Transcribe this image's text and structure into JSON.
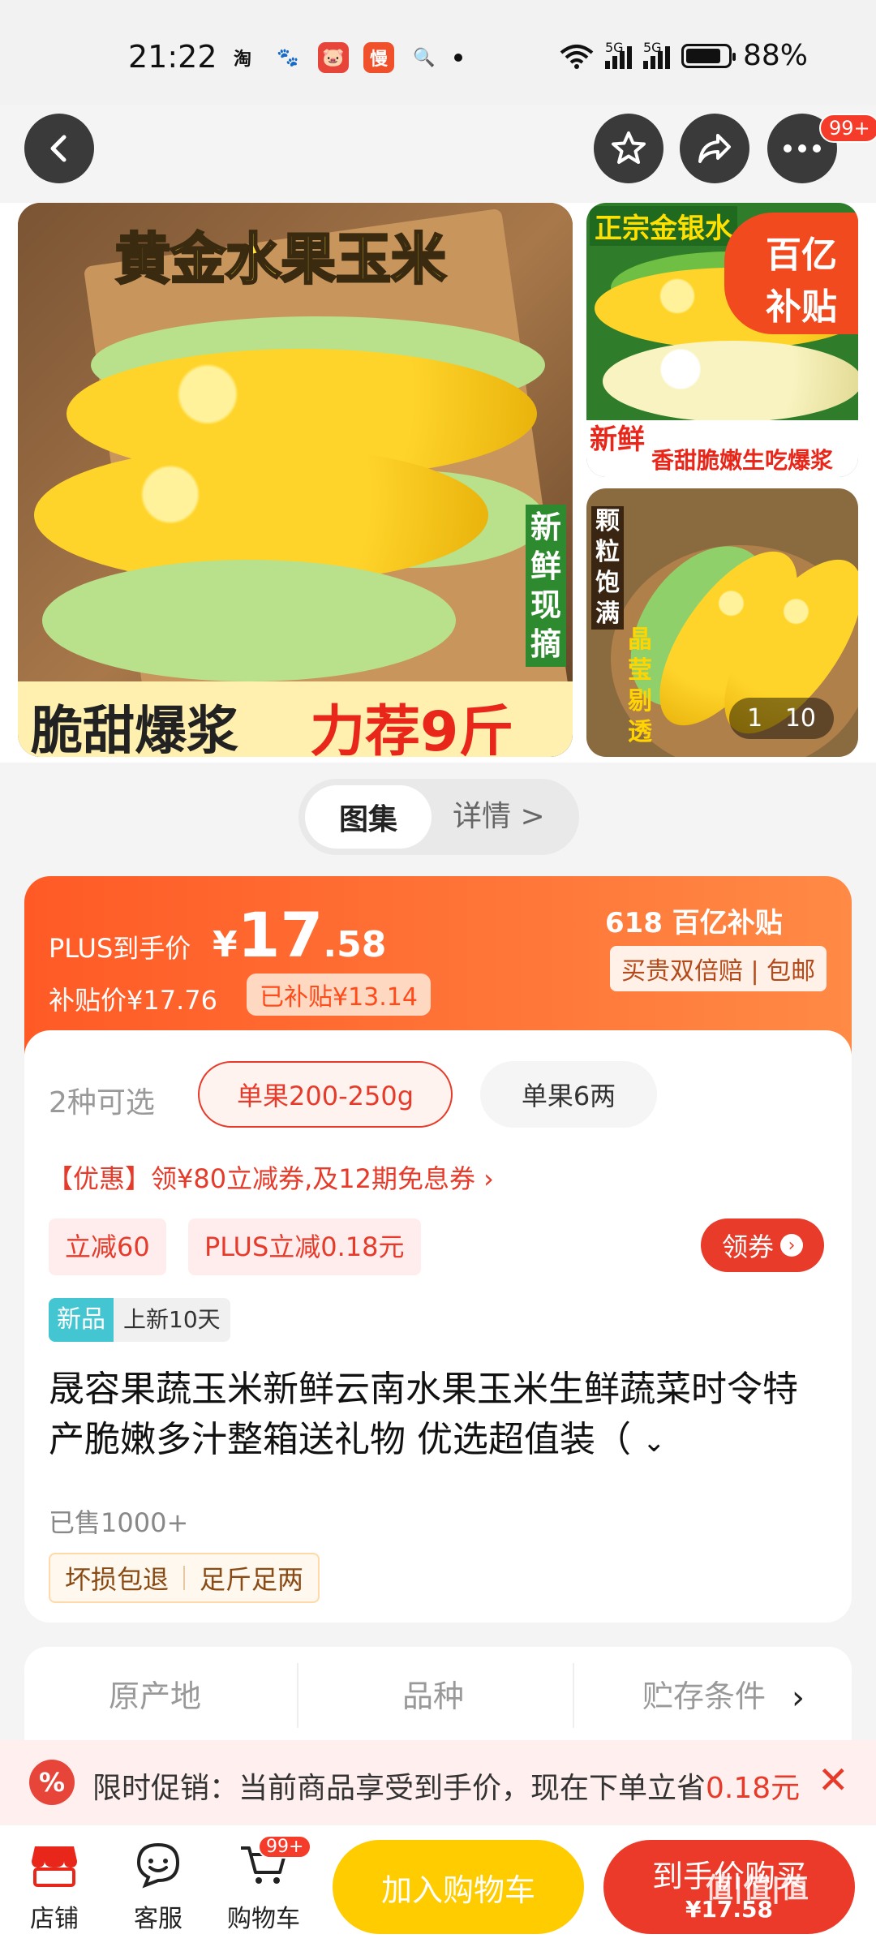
{
  "status": {
    "time": "21:22",
    "apps": [
      "淘",
      "🐾",
      "🐷",
      "慢",
      "🔍"
    ],
    "network1": "5G",
    "network2": "5G",
    "battery": "88%"
  },
  "topbar": {
    "badge": "99+"
  },
  "gallery": {
    "main_title": "黄金水果玉米",
    "main_bottom_left": "脆甜爆浆",
    "main_bottom_right": "力荐9斤",
    "main_side": "新鲜现摘",
    "side1_top": "正宗金银水",
    "side1_bottom": "香甜脆嫩生吃爆浆",
    "side1_fresh": "新鲜",
    "side_badge_line1": "百亿",
    "side_badge_line2": "补贴",
    "side2_left": "颗粒饱满",
    "side2_right": "晶莹剔透",
    "page_current": "1",
    "page_total": "10"
  },
  "tabs": {
    "gallery": "图集",
    "detail": "详情 >"
  },
  "price": {
    "plus_label": "PLUS到手价",
    "yen": "¥",
    "int": "17",
    "dec": ".58",
    "subsidy_price": "补贴价¥17.76",
    "subsidy_tag": "已补贴¥13.14",
    "badge_618": "618  百亿补贴",
    "guarantee": "买贵双倍赔 | 包邮"
  },
  "sku": {
    "title": "2种可选",
    "options": [
      "单果200-250g",
      "单果6两"
    ]
  },
  "promo_line": "【优惠】领¥80立减券,及12期免息券 ›",
  "tags": {
    "t1": "立减60",
    "t2": "PLUS立减0.18元",
    "coupon": "领券"
  },
  "new_badge": {
    "a": "新品",
    "b": "上新10天"
  },
  "product": {
    "title": "晟容果蔬玉米新鲜云南水果玉米生鲜蔬菜时令特产脆嫩多汁整箱送礼物 优选超值装（",
    "sold": "已售1000+",
    "services": [
      "坏损包退",
      "足斤足两"
    ]
  },
  "params": [
    "原产地",
    "品种",
    "贮存条件"
  ],
  "promo_bar": {
    "text": "限时促销：当前商品享受到手价，现在下单立省",
    "amount": "0.18元"
  },
  "bottom": {
    "shop": "店铺",
    "service": "客服",
    "cart": "购物车",
    "cart_badge": "99+",
    "add_cart": "加入购物车",
    "buy": "到手价购买",
    "buy_price": "¥17.58",
    "watermark": "值|值|值"
  }
}
